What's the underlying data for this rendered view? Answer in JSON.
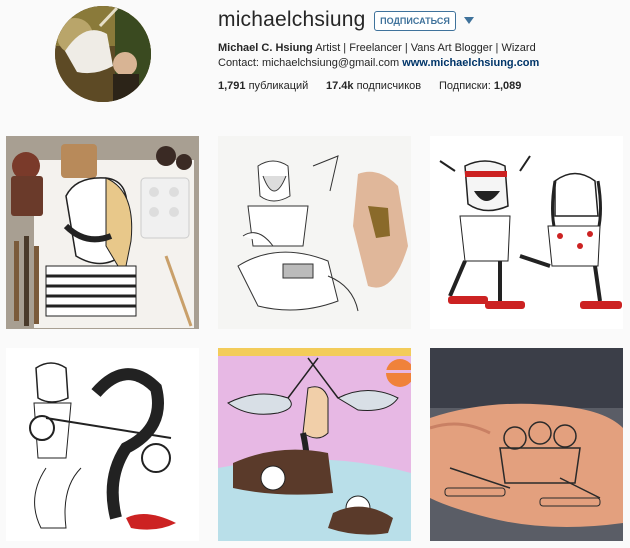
{
  "profile": {
    "username": "michaelchsiung",
    "follow_label": "ПОДПИСАТЬСЯ",
    "bio_name": "Michael C. Hsiung",
    "bio_text": " Artist | Freelancer | Vans Art Blogger | Wizard Contact: michaelchsiung@gmail.com ",
    "bio_link": "www.michaelchsiung.com"
  },
  "stats": {
    "posts_count": "1,791",
    "posts_label": " публикаций",
    "followers_count": "17.4k",
    "followers_label": " подписчиков",
    "following_label": "Подписки: ",
    "following_count": "1,089"
  },
  "colors": {
    "accent": "#3f729b",
    "link": "#003569"
  },
  "posts": [
    {
      "subject": "bearded man drawing with paints and brushes"
    },
    {
      "subject": "centaur sketch and hand holding figurine"
    },
    {
      "subject": "two skateboarders illustration"
    },
    {
      "subject": "warrior and serpent illustration"
    },
    {
      "subject": "mermaid and narwhals color illustration"
    },
    {
      "subject": "skateboarders tattoo on arm"
    }
  ]
}
